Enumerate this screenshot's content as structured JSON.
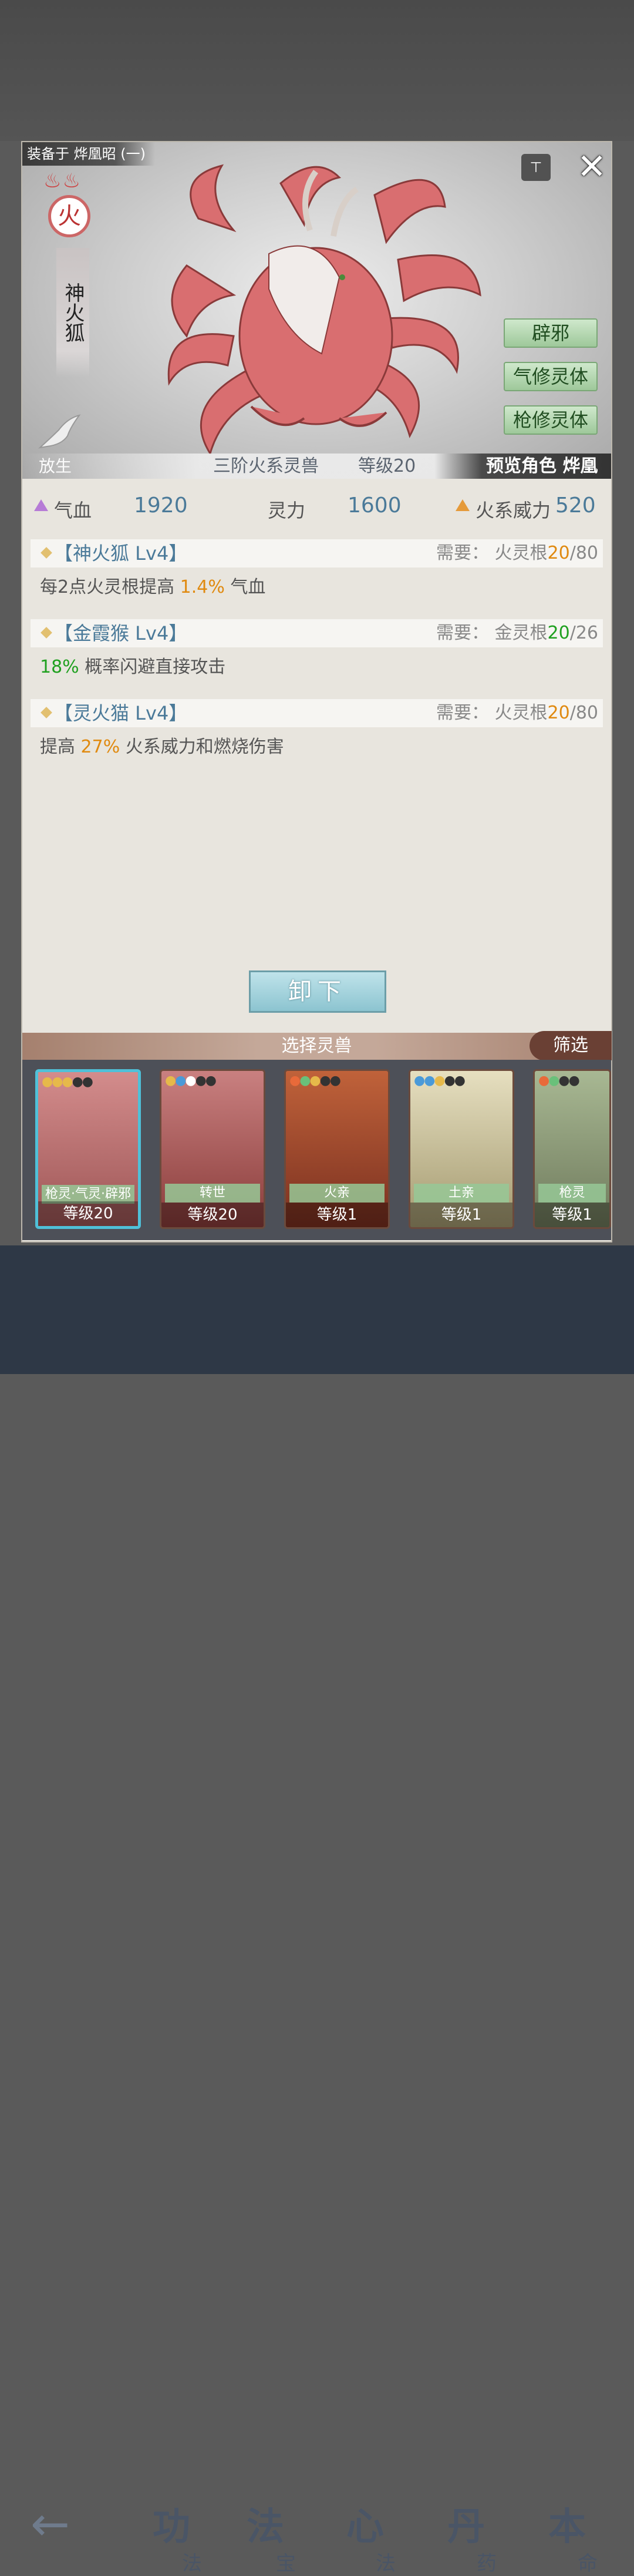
{
  "panel": {
    "equip_tag": "装备于 烨凰昭 (一)",
    "element": "火",
    "beast_name": "神火狐",
    "release_label": "放生",
    "traits": [
      "辟邪",
      "气修灵体",
      "枪修灵体"
    ],
    "info": {
      "tier": "三阶火系灵兽",
      "level": "等级20",
      "preview": "预览角色 烨凰昭"
    }
  },
  "stats": {
    "hp_label": "气血",
    "hp_value": "1920",
    "spirit_label": "灵力",
    "spirit_value": "1600",
    "fire_label": "火系威力",
    "fire_value": "520"
  },
  "skills": [
    {
      "name": "【神火狐 Lv4】",
      "req_prefix": "需要：",
      "req_root": "火灵根",
      "req_cur": "20",
      "req_max": "/80",
      "desc_pre": "每2点火灵根提高 ",
      "desc_hl": "1.4%",
      "desc_post": " 气血"
    },
    {
      "name": "【金霞猴 Lv4】",
      "req_prefix": "需要：",
      "req_root": "金灵根",
      "req_cur": "20",
      "req_max": "/26",
      "desc_pre": "",
      "desc_hl": "18%",
      "desc_post": " 概率闪避直接攻击"
    },
    {
      "name": "【灵火猫 Lv4】",
      "req_prefix": "需要：",
      "req_root": "火灵根",
      "req_cur": "20",
      "req_max": "/80",
      "desc_pre": "提高 ",
      "desc_hl": "27%",
      "desc_post": " 火系威力和燃烧伤害"
    }
  ],
  "unequip_label": "卸下",
  "choose_label": "选择灵兽",
  "filter_label": "筛选",
  "cards": [
    {
      "trait": "枪灵·气灵·辟邪",
      "level": "等级20",
      "bg": "#b26b6b"
    },
    {
      "trait": "转世",
      "level": "等级20",
      "bg": "#a45a58"
    },
    {
      "trait": "火亲",
      "level": "等级1",
      "bg": "#9c4a36"
    },
    {
      "trait": "土亲",
      "level": "等级1",
      "bg": "#bdb38c"
    },
    {
      "trait": "枪灵",
      "level": "等级1",
      "bg": "#8ea080"
    }
  ],
  "nav": [
    {
      "big": "功",
      "small": "法"
    },
    {
      "big": "法",
      "small": "宝"
    },
    {
      "big": "心",
      "small": "法"
    },
    {
      "big": "丹",
      "small": "药"
    },
    {
      "big": "本",
      "small": "命"
    }
  ],
  "colors": {
    "accent_blue": "#4b7a99",
    "highlight_orange": "#e08a10",
    "highlight_green": "#1fa01f",
    "trait_green": "#9ec89a"
  }
}
